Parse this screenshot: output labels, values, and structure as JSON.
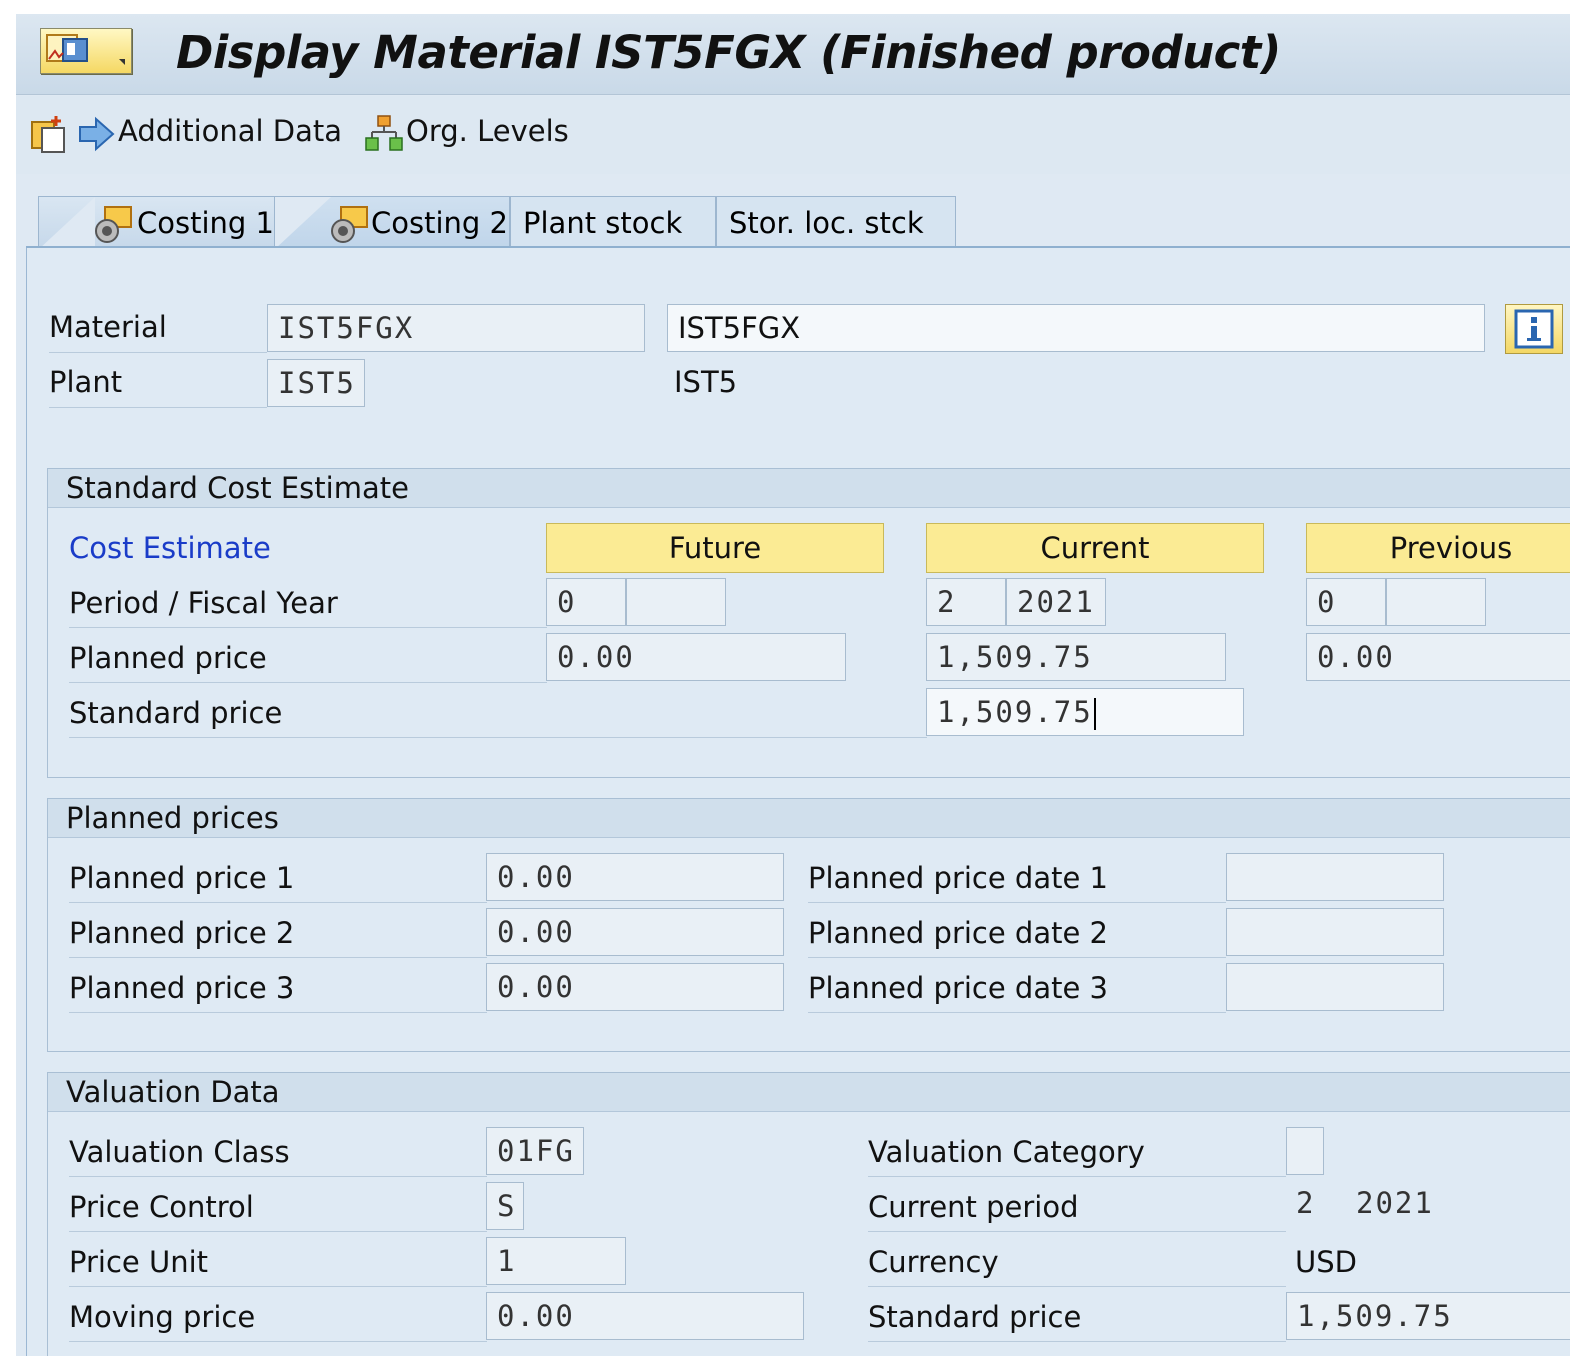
{
  "window": {
    "title": "Display Material IST5FGX (Finished product)"
  },
  "toolbar": {
    "additional_data": "Additional Data",
    "org_levels": "Org. Levels"
  },
  "tabs": [
    {
      "label": "Costing 1"
    },
    {
      "label": "Costing 2"
    },
    {
      "label": "Plant stock"
    },
    {
      "label": "Stor. loc. stck"
    }
  ],
  "header": {
    "material_label": "Material",
    "material_value": "IST5FGX",
    "material_desc": "IST5FGX",
    "plant_label": "Plant",
    "plant_value": "IST5",
    "plant_desc": "IST5"
  },
  "standard_cost": {
    "title": "Standard Cost Estimate",
    "cost_estimate_label": "Cost Estimate",
    "col_future": "Future",
    "col_current": "Current",
    "col_previous": "Previous",
    "period_label": "Period / Fiscal Year",
    "planned_label": "Planned price",
    "standard_label": "Standard price",
    "future_period": "0",
    "future_year": "",
    "current_period": "2",
    "current_year": "2021",
    "previous_period": "0",
    "previous_year": "",
    "future_planned": "0.00",
    "current_planned": "1,509.75",
    "previous_planned": "0.00",
    "current_standard": "1,509.75"
  },
  "planned_prices": {
    "title": "Planned prices",
    "p1_label": "Planned price 1",
    "p2_label": "Planned price 2",
    "p3_label": "Planned price 3",
    "p1_value": "0.00",
    "p2_value": "0.00",
    "p3_value": "0.00",
    "d1_label": "Planned price date 1",
    "d2_label": "Planned price date 2",
    "d3_label": "Planned price date 3",
    "d1_value": "",
    "d2_value": "",
    "d3_value": ""
  },
  "valuation": {
    "title": "Valuation Data",
    "class_label": "Valuation Class",
    "class_value": "01FG",
    "control_label": "Price Control",
    "control_value": "S",
    "unit_label": "Price Unit",
    "unit_value": "1",
    "moving_label": "Moving price",
    "moving_value": "0.00",
    "category_label": "Valuation Category",
    "category_value": "",
    "current_period_label": "Current period",
    "current_period_value": "2",
    "current_period_year": "2021",
    "currency_label": "Currency",
    "currency_value": "USD",
    "standard_label": "Standard price",
    "standard_value": "1,509.75"
  }
}
